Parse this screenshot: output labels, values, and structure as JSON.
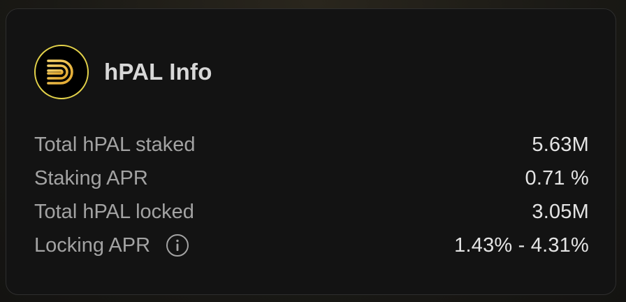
{
  "card": {
    "title": "hPAL Info",
    "logo_icon": "paladin-logo-icon",
    "accent_color": "#e3d24a"
  },
  "stats": [
    {
      "label": "Total hPAL staked",
      "value": "5.63M"
    },
    {
      "label": "Staking APR",
      "value": "0.71 %"
    },
    {
      "label": "Total hPAL locked",
      "value": "3.05M"
    },
    {
      "label": "Locking APR",
      "value": "1.43% - 4.31%",
      "icon": "info-icon"
    }
  ]
}
